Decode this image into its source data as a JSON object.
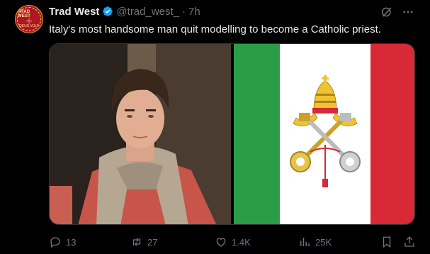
{
  "author": {
    "name": "Trad West",
    "handle": "@trad_west_",
    "time": "7h",
    "separator": "·",
    "avatar_text": {
      "top": "TRAD WEST",
      "mid": "☩",
      "bottom": "DEUS VULT"
    }
  },
  "tweet": {
    "text": "Italy's most handsome man quit modelling to become a Catholic priest."
  },
  "stats": {
    "replies": "13",
    "reposts": "27",
    "likes": "1.4K",
    "views": "25K"
  },
  "icons": {
    "verified": "verified-badge-icon",
    "grok": "grok-icon",
    "more": "more-icon",
    "reply": "reply-icon",
    "repost": "repost-icon",
    "like": "heart-icon",
    "views": "views-icon",
    "bookmark": "bookmark-icon",
    "share": "share-icon"
  },
  "colors": {
    "background": "#000000",
    "text_primary": "#e7e9ea",
    "text_secondary": "#71767b",
    "verified": "#1d9bf0",
    "flag_green": "#2b9d47",
    "flag_red": "#d72936",
    "avatar_red": "#b0161f"
  }
}
